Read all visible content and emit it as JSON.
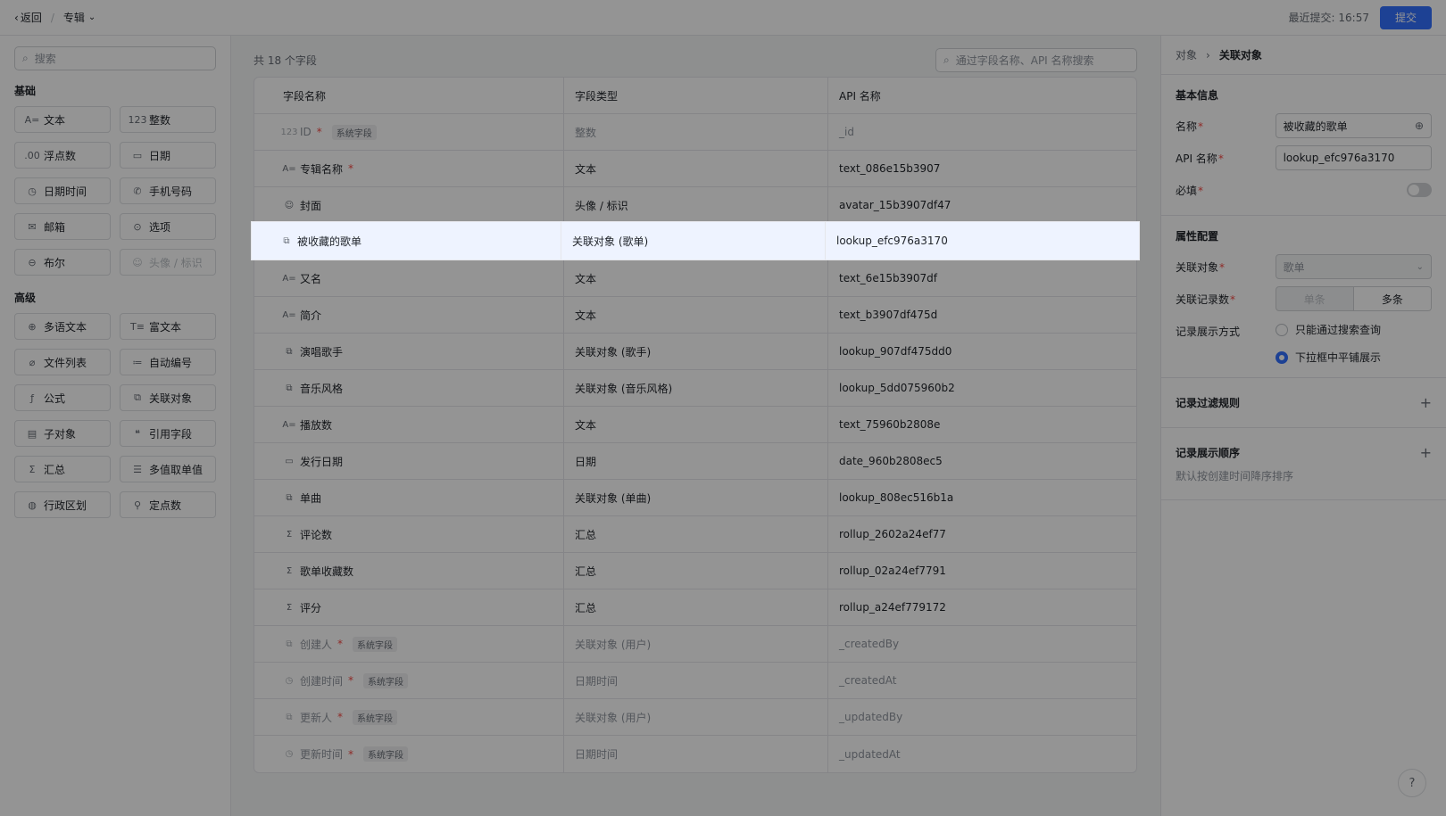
{
  "header": {
    "back_label": "返回",
    "breadcrumb": "专辑",
    "last_submit": "最近提交: 16:57",
    "submit_label": "提交"
  },
  "left": {
    "search_placeholder": "搜索",
    "basic_title": "基础",
    "advanced_title": "高级",
    "basic": [
      {
        "icon": "A=",
        "label": "文本",
        "name": "text"
      },
      {
        "icon": "123",
        "label": "整数",
        "name": "integer"
      },
      {
        "icon": ".00",
        "label": "浮点数",
        "name": "float"
      },
      {
        "icon": "▭",
        "label": "日期",
        "name": "date"
      },
      {
        "icon": "◷",
        "label": "日期时间",
        "name": "datetime"
      },
      {
        "icon": "✆",
        "label": "手机号码",
        "name": "phone"
      },
      {
        "icon": "✉",
        "label": "邮箱",
        "name": "email"
      },
      {
        "icon": "⊙",
        "label": "选项",
        "name": "option"
      },
      {
        "icon": "⊖",
        "label": "布尔",
        "name": "boolean"
      },
      {
        "icon": "☺",
        "label": "头像 / 标识",
        "name": "avatar",
        "disabled": true
      }
    ],
    "advanced": [
      {
        "icon": "⊕",
        "label": "多语文本",
        "name": "multilang"
      },
      {
        "icon": "T≡",
        "label": "富文本",
        "name": "richtext"
      },
      {
        "icon": "⌀",
        "label": "文件列表",
        "name": "filelist"
      },
      {
        "icon": "≔",
        "label": "自动编号",
        "name": "autonumber"
      },
      {
        "icon": "ƒ",
        "label": "公式",
        "name": "formula"
      },
      {
        "icon": "⧉",
        "label": "关联对象",
        "name": "lookup"
      },
      {
        "icon": "▤",
        "label": "子对象",
        "name": "subobject"
      },
      {
        "icon": "❝",
        "label": "引用字段",
        "name": "reference"
      },
      {
        "icon": "Σ",
        "label": "汇总",
        "name": "rollup"
      },
      {
        "icon": "☰",
        "label": "多值取单值",
        "name": "multivalue"
      },
      {
        "icon": "◍",
        "label": "行政区划",
        "name": "region"
      },
      {
        "icon": "⚲",
        "label": "定点数",
        "name": "decimal"
      }
    ]
  },
  "middle": {
    "count_label": "共 18 个字段",
    "search_placeholder": "通过字段名称、API 名称搜索",
    "columns": [
      "字段名称",
      "字段类型",
      "API 名称"
    ],
    "rows": [
      {
        "icon": "123",
        "name": "ID",
        "required": true,
        "system": true,
        "type": "整数",
        "api": "_id"
      },
      {
        "icon": "A=",
        "name": "专辑名称",
        "required": true,
        "system": false,
        "type": "文本",
        "api": "text_086e15b3907"
      },
      {
        "icon": "☺",
        "name": "封面",
        "required": false,
        "system": false,
        "type": "头像 / 标识",
        "api": "avatar_15b3907df47"
      },
      {
        "icon": "⧉",
        "name": "被收藏的歌单",
        "required": false,
        "system": false,
        "type": "关联对象 (歌单)",
        "api": "lookup_efc976a3170",
        "selected": true
      },
      {
        "icon": "A=",
        "name": "又名",
        "required": false,
        "system": false,
        "type": "文本",
        "api": "text_6e15b3907df"
      },
      {
        "icon": "A=",
        "name": "简介",
        "required": false,
        "system": false,
        "type": "文本",
        "api": "text_b3907df475d"
      },
      {
        "icon": "⧉",
        "name": "演唱歌手",
        "required": false,
        "system": false,
        "type": "关联对象 (歌手)",
        "api": "lookup_907df475dd0"
      },
      {
        "icon": "⧉",
        "name": "音乐风格",
        "required": false,
        "system": false,
        "type": "关联对象 (音乐风格)",
        "api": "lookup_5dd075960b2"
      },
      {
        "icon": "A=",
        "name": "播放数",
        "required": false,
        "system": false,
        "type": "文本",
        "api": "text_75960b2808e"
      },
      {
        "icon": "▭",
        "name": "发行日期",
        "required": false,
        "system": false,
        "type": "日期",
        "api": "date_960b2808ec5"
      },
      {
        "icon": "⧉",
        "name": "单曲",
        "required": false,
        "system": false,
        "type": "关联对象 (单曲)",
        "api": "lookup_808ec516b1a"
      },
      {
        "icon": "Σ",
        "name": "评论数",
        "required": false,
        "system": false,
        "type": "汇总",
        "api": "rollup_2602a24ef77"
      },
      {
        "icon": "Σ",
        "name": "歌单收藏数",
        "required": false,
        "system": false,
        "type": "汇总",
        "api": "rollup_02a24ef7791"
      },
      {
        "icon": "Σ",
        "name": "评分",
        "required": false,
        "system": false,
        "type": "汇总",
        "api": "rollup_a24ef779172"
      },
      {
        "icon": "⧉",
        "name": "创建人",
        "required": true,
        "system": true,
        "type": "关联对象 (用户)",
        "api": "_createdBy"
      },
      {
        "icon": "◷",
        "name": "创建时间",
        "required": true,
        "system": true,
        "type": "日期时间",
        "api": "_createdAt"
      },
      {
        "icon": "⧉",
        "name": "更新人",
        "required": true,
        "system": true,
        "type": "关联对象 (用户)",
        "api": "_updatedBy"
      },
      {
        "icon": "◷",
        "name": "更新时间",
        "required": true,
        "system": true,
        "type": "日期时间",
        "api": "_updatedAt"
      }
    ],
    "system_tag": "系统字段",
    "required_mark": "*"
  },
  "right": {
    "crumb_parent": "对象",
    "crumb_current": "关联对象",
    "basic_title": "基本信息",
    "name_label": "名称",
    "name_value": "被收藏的歌单",
    "api_label": "API 名称",
    "api_value": "lookup_efc976a3170",
    "required_label": "必填",
    "props_title": "属性配置",
    "lookup_label": "关联对象",
    "lookup_value": "歌单",
    "count_label": "关联记录数",
    "count_single": "单条",
    "count_multi": "多条",
    "display_label": "记录展示方式",
    "display_opt1": "只能通过搜索查询",
    "display_opt2": "下拉框中平铺展示",
    "filter_title": "记录过滤规则",
    "order_title": "记录展示顺序",
    "order_hint": "默认按创建时间降序排序"
  },
  "colors": {
    "accent": "#3370ff",
    "required": "#f54a45"
  }
}
